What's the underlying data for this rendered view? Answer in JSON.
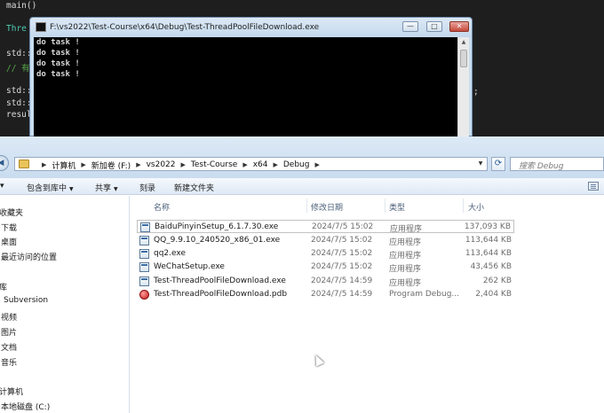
{
  "editor": {
    "lines": [
      {
        "text": "main()",
        "cls": "c-plain"
      },
      {
        "text": "Thre",
        "cls": "c-type"
      },
      {
        "text": "std::",
        "cls": "c-plain"
      },
      {
        "text": "// 有",
        "cls": "c-comment"
      },
      {
        "text": "std::",
        "cls": "c-plain"
      },
      {
        "text": "std::",
        "cls": "c-plain"
      },
      {
        "text": "resul",
        "cls": "c-plain"
      }
    ],
    "semicolon": ";"
  },
  "console": {
    "title": "F:\\vs2022\\Test-Course\\x64\\Debug\\Test-ThreadPoolFileDownload.exe",
    "output": [
      "do task !",
      "do task !",
      "do task !",
      "do task !"
    ],
    "buttons": {
      "minimize": "—",
      "maximize": "□",
      "close": "✕"
    }
  },
  "explorer": {
    "breadcrumbs": [
      "计算机",
      "新加卷 (F:)",
      "vs2022",
      "Test-Course",
      "x64",
      "Debug"
    ],
    "search_placeholder": "搜索 Debug",
    "toolbar": [
      "包含到库中",
      "共享",
      "刻录",
      "新建文件夹"
    ],
    "nav": {
      "favorites": "收藏夹",
      "favorites_items": [
        "下载",
        "桌面",
        "最近访问的位置"
      ],
      "libraries": "库",
      "libraries_items": [
        "Subversion",
        "视频",
        "图片",
        "文档",
        "音乐"
      ],
      "computer": "计算机",
      "computer_items": [
        "本地磁盘 (C:)"
      ]
    },
    "columns": {
      "name": "名称",
      "date": "修改日期",
      "type": "类型",
      "size": "大小"
    },
    "files": [
      {
        "name": "BaiduPinyinSetup_6.1.7.30.exe",
        "date": "2024/7/5 15:02",
        "type": "应用程序",
        "size": "137,093 KB",
        "icon": "exe"
      },
      {
        "name": "QQ_9.9.10_240520_x86_01.exe",
        "date": "2024/7/5 15:02",
        "type": "应用程序",
        "size": "113,644 KB",
        "icon": "exe"
      },
      {
        "name": "qq2.exe",
        "date": "2024/7/5 15:02",
        "type": "应用程序",
        "size": "113,644 KB",
        "icon": "exe"
      },
      {
        "name": "WeChatSetup.exe",
        "date": "2024/7/5 15:02",
        "type": "应用程序",
        "size": "43,456 KB",
        "icon": "exe"
      },
      {
        "name": "Test-ThreadPoolFileDownload.exe",
        "date": "2024/7/5 14:59",
        "type": "应用程序",
        "size": "262 KB",
        "icon": "exe"
      },
      {
        "name": "Test-ThreadPoolFileDownload.pdb",
        "date": "2024/7/5 14:59",
        "type": "Program Debug...",
        "size": "2,404 KB",
        "icon": "pdb"
      }
    ]
  }
}
